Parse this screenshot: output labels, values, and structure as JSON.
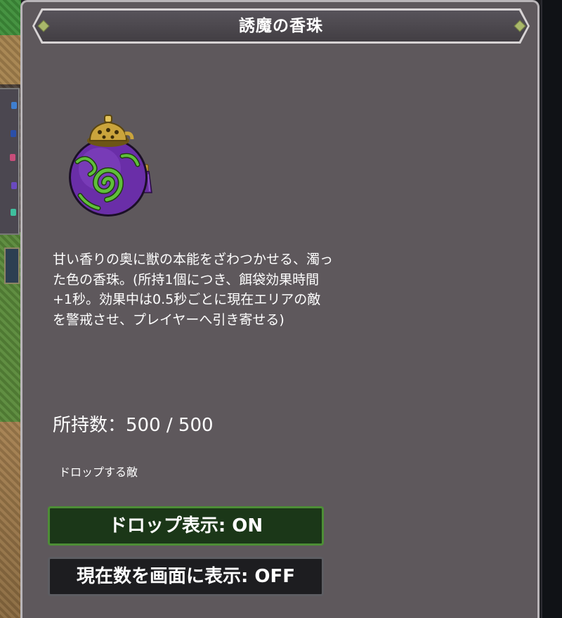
{
  "panel": {
    "title": "誘魔の香珠",
    "item_icon": "purple-incense-orb-icon",
    "description": "甘い香りの奥に獣の本能をざわつかせる、濁った色の香珠。(所持1個につき、餌袋効果時間+1秒。効果中は0.5秒ごとに現在エリアの敵を警戒させ、プレイヤーへ引き寄せる)",
    "count_text": "所持数：500 / 500",
    "drop_enemies_label": "ドロップする敵"
  },
  "buttons": {
    "drop_display": "ドロップ表示: ON",
    "show_count_on_screen": "現在数を画面に表示: OFF"
  },
  "colors": {
    "panel_bg": "#5e585c",
    "on_button_bg": "#1b3718",
    "on_button_border": "#4d8e36",
    "off_button_bg": "#1d1d20"
  }
}
